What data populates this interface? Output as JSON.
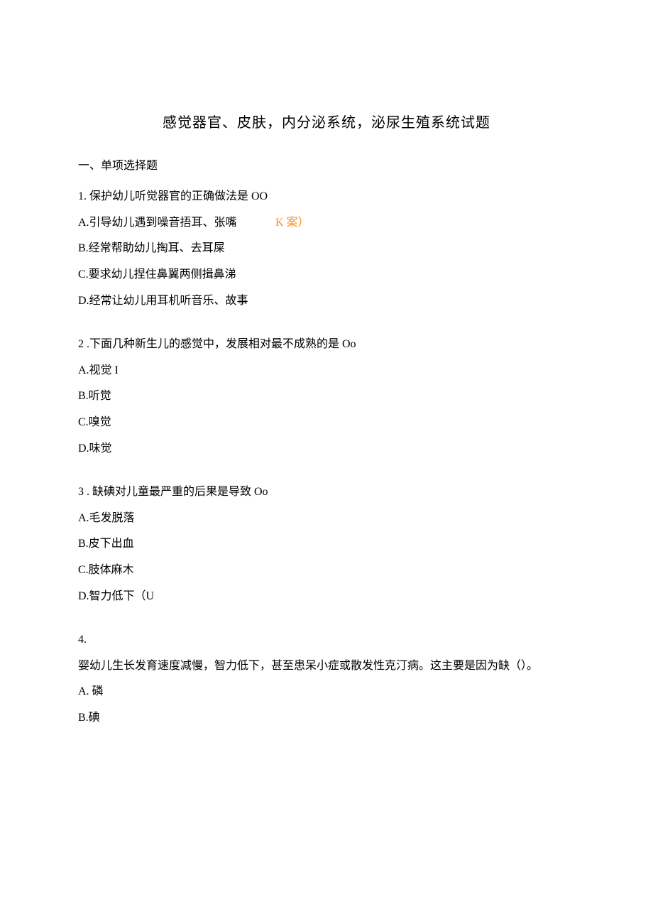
{
  "title": "感觉器官、皮肤，内分泌系统，泌尿生殖系统试题",
  "sectionHeader": "一、单项选择题",
  "q1": {
    "stem": "1. 保护幼儿听觉器官的正确做法是 OO",
    "optA": "A.引导幼儿遇到噪音捂耳、张嘴",
    "hint": "K 案）",
    "optB": "B.经常帮助幼儿掏耳、去耳屎",
    "optC": "C.要求幼儿捏住鼻翼两侧揖鼻涕",
    "optD": "D.经常让幼儿用耳机听音乐、故事"
  },
  "q2": {
    "stem": "2 .下面几种新生儿的感觉中，发展相对最不成熟的是 Oo",
    "optA": "A.视觉 I",
    "optB": "B.听觉",
    "optC": "C.嗅觉",
    "optD": "D.味觉"
  },
  "q3": {
    "stem": "3 . 缺碘对儿童最严重的后果是导致 Oo",
    "optA": "A.毛发脱落",
    "optB": "B.皮下出血",
    "optC": "C.肢体麻木",
    "optD": "D.智力低下（U"
  },
  "q4": {
    "num": "4.",
    "stem": "婴幼儿生长发育速度减慢，智力低下，甚至患呆小症或散发性克汀病。这主要是因为缺（）。",
    "optA": "A. 磷",
    "optB": "B.碘"
  }
}
